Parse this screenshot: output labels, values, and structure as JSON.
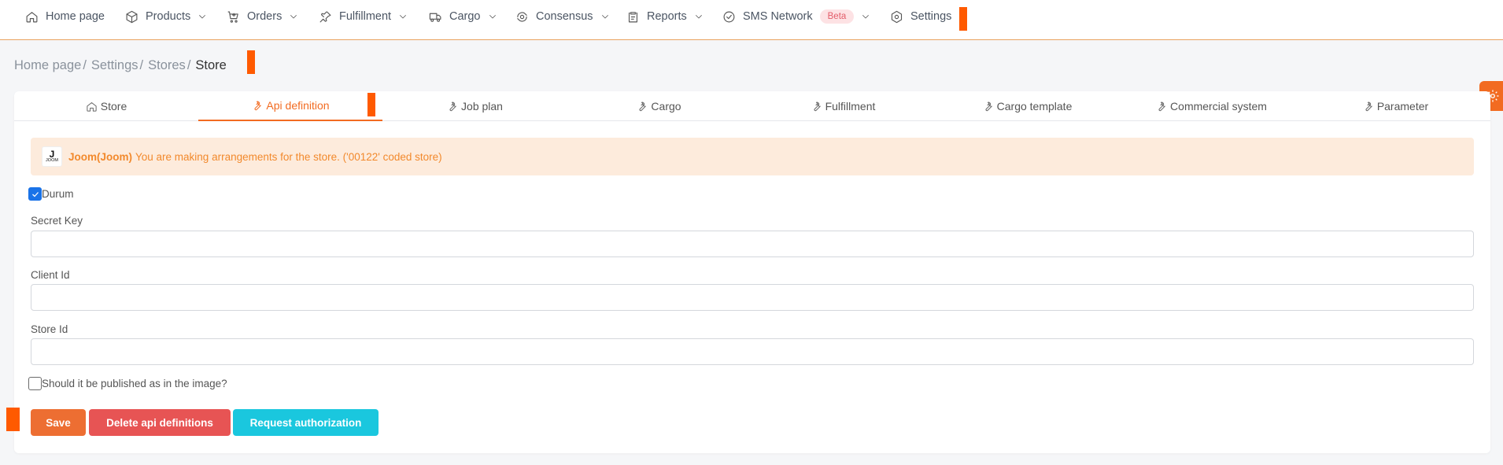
{
  "nav": {
    "items": [
      {
        "label": "Home page",
        "icon": "home-icon"
      },
      {
        "label": "Products",
        "icon": "cube-icon",
        "dropdown": true
      },
      {
        "label": "Orders",
        "icon": "cart-icon",
        "dropdown": true
      },
      {
        "label": "Fulfillment",
        "icon": "pin-icon",
        "dropdown": true
      },
      {
        "label": "Cargo",
        "icon": "truck-icon",
        "dropdown": true
      },
      {
        "label": "Consensus",
        "icon": "cycle-icon",
        "dropdown": true
      },
      {
        "label": "Reports",
        "icon": "clipboard-icon",
        "dropdown": true
      },
      {
        "label": "SMS Network",
        "icon": "check-circle-icon",
        "dropdown": true,
        "badge": "Beta"
      },
      {
        "label": "Settings",
        "icon": "hexagon-gear-icon"
      }
    ]
  },
  "breadcrumb": {
    "items": [
      "Home page",
      "Settings",
      "Stores"
    ],
    "separator": "/",
    "current": "Store"
  },
  "tabs": {
    "items": [
      "Store",
      "Api definition",
      "Job plan",
      "Cargo",
      "Fulfillment",
      "Cargo template",
      "Commercial system",
      "Parameter"
    ],
    "active": "Api definition"
  },
  "alert": {
    "logo_letter": "J",
    "logo_word": "JOOM",
    "store": "Joom(Joom)",
    "message": "You are making arrangements for the store. ('00122' coded store)"
  },
  "form": {
    "status_label": "Durum",
    "status_checked": true,
    "secret_key_label": "Secret Key",
    "secret_key_value": "",
    "client_id_label": "Client Id",
    "client_id_value": "",
    "store_id_label": "Store Id",
    "store_id_value": "",
    "publish_label": "Should it be published as in the image?",
    "publish_checked": false
  },
  "buttons": {
    "save": "Save",
    "delete": "Delete api definitions",
    "authorize": "Request authorization"
  },
  "colors": {
    "accent": "#f26b21",
    "save": "#ed6e32",
    "delete": "#e75454",
    "authorize": "#1ac7de",
    "alert_bg": "#fdebdc",
    "alert_text": "#f2892c"
  }
}
